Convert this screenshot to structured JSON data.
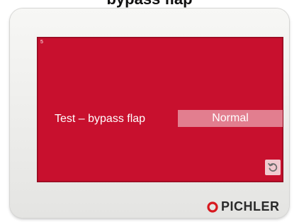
{
  "header": {
    "caption": "bypass flap"
  },
  "screen": {
    "corner_label": "5",
    "test_label": "Test – bypass flap",
    "mode_value": "Normal",
    "reset_icon": "reset-icon"
  },
  "brand": {
    "name": "PICHLER",
    "mark_icon": "pichler-logo-icon"
  },
  "colors": {
    "screen_red": "#c8102e",
    "mode_box": "#e27e8f",
    "reset_button": "#f1c9cf",
    "logo_red": "#d7191f"
  }
}
